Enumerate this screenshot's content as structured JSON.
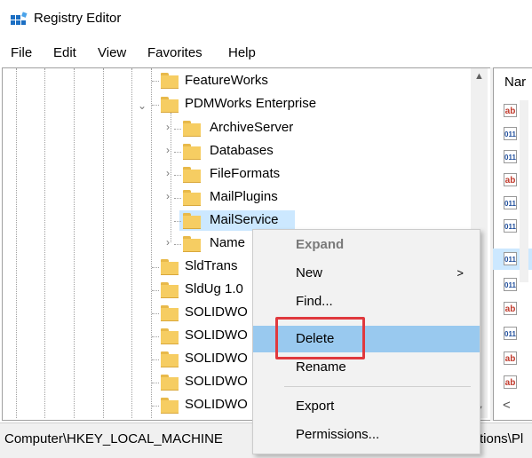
{
  "window": {
    "title": "Registry Editor"
  },
  "menubar": {
    "items": [
      "File",
      "Edit",
      "View",
      "Favorites",
      "Help"
    ]
  },
  "tree": {
    "nodes": [
      {
        "label": "FeatureWorks"
      },
      {
        "label": "PDMWorks Enterprise"
      },
      {
        "label": "ArchiveServer"
      },
      {
        "label": "Databases"
      },
      {
        "label": "FileFormats"
      },
      {
        "label": "MailPlugins"
      },
      {
        "label": "MailService"
      },
      {
        "label": "Name"
      },
      {
        "label": "SldTrans"
      },
      {
        "label": "SldUg 1.0"
      },
      {
        "label": "SOLIDWO"
      },
      {
        "label": "SOLIDWO"
      },
      {
        "label": "SOLIDWO"
      },
      {
        "label": "SOLIDWO"
      },
      {
        "label": "SOLIDWO"
      }
    ],
    "selected": "MailService"
  },
  "list": {
    "header": "Nar",
    "icons": [
      "ab",
      "011",
      "011",
      "ab",
      "011",
      "011",
      "011",
      "011",
      "ab",
      "011",
      "ab",
      "ab"
    ],
    "scroll_left": "<"
  },
  "context_menu": {
    "items": [
      "Expand",
      "New",
      "Find...",
      "Delete",
      "Rename",
      "Export",
      "Permissions..."
    ],
    "submenu_arrow": ">",
    "highlighted": "Delete"
  },
  "statusbar": {
    "path_left": "Computer\\HKEY_LOCAL_MACHINE",
    "path_right": "tions\\Pl"
  },
  "colors": {
    "selection": "#cce8ff",
    "menu_highlight": "#99c9ef",
    "annotation_box": "#e0393e",
    "folder": "#f6cd62"
  }
}
